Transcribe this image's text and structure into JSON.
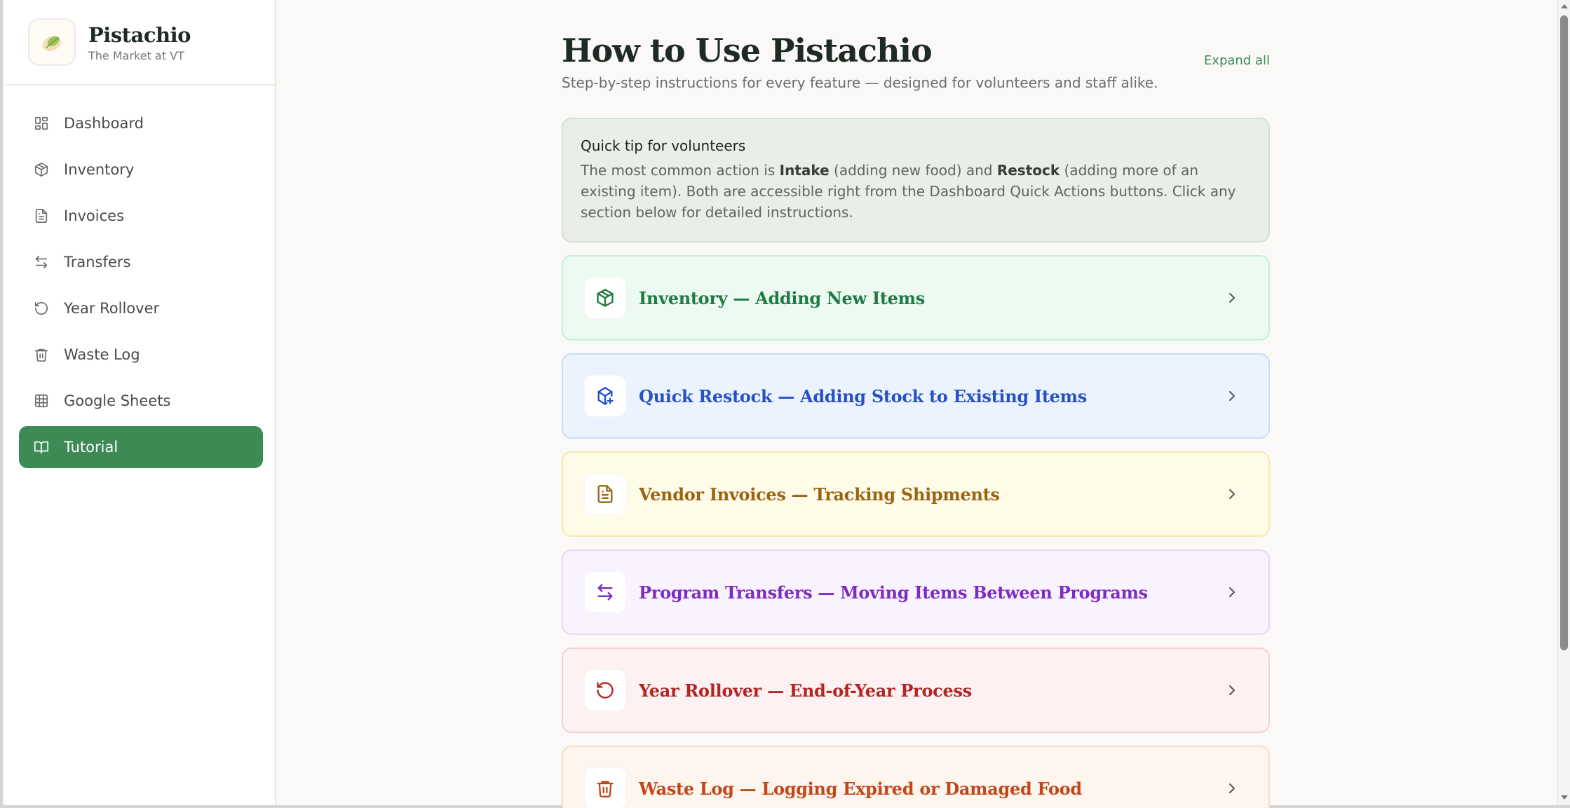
{
  "brand": {
    "name": "Pistachio",
    "subtitle": "The Market at VT"
  },
  "sidebar": {
    "items": [
      {
        "label": "Dashboard",
        "icon": "dashboard-icon"
      },
      {
        "label": "Inventory",
        "icon": "box-icon"
      },
      {
        "label": "Invoices",
        "icon": "file-text-icon"
      },
      {
        "label": "Transfers",
        "icon": "arrows-swap-icon"
      },
      {
        "label": "Year Rollover",
        "icon": "rotate-ccw-icon"
      },
      {
        "label": "Waste Log",
        "icon": "trash-icon"
      },
      {
        "label": "Google Sheets",
        "icon": "table-icon"
      },
      {
        "label": "Tutorial",
        "icon": "book-open-icon",
        "active": true
      }
    ]
  },
  "page": {
    "title": "How to Use Pistachio",
    "subtitle": "Step-by-step instructions for every feature — designed for volunteers and staff alike.",
    "expand_all": "Expand all"
  },
  "tip": {
    "title": "Quick tip for volunteers",
    "body_1": "The most common action is ",
    "bold_1": "Intake",
    "body_2": " (adding new food) and ",
    "bold_2": "Restock",
    "body_3": " (adding more of an existing item). Both are accessible right from the Dashboard Quick Actions buttons. Click any section below for detailed instructions."
  },
  "sections": [
    {
      "title": "Inventory — Adding New Items",
      "icon": "box-icon",
      "color": "#1f7a43"
    },
    {
      "title": "Quick Restock — Adding Stock to Existing Items",
      "icon": "box-plus-icon",
      "color": "#2750c5"
    },
    {
      "title": "Vendor Invoices — Tracking Shipments",
      "icon": "file-text-icon",
      "color": "#9a6412"
    },
    {
      "title": "Program Transfers — Moving Items Between Programs",
      "icon": "arrows-swap-icon",
      "color": "#7e2bc1"
    },
    {
      "title": "Year Rollover — End-of-Year Process",
      "icon": "rotate-ccw-icon",
      "color": "#b32424"
    },
    {
      "title": "Waste Log — Logging Expired or Damaged Food",
      "icon": "trash-icon",
      "color": "#c2461a"
    }
  ],
  "colors": {
    "accent": "#3d8a55",
    "background": "#faf9f7"
  }
}
